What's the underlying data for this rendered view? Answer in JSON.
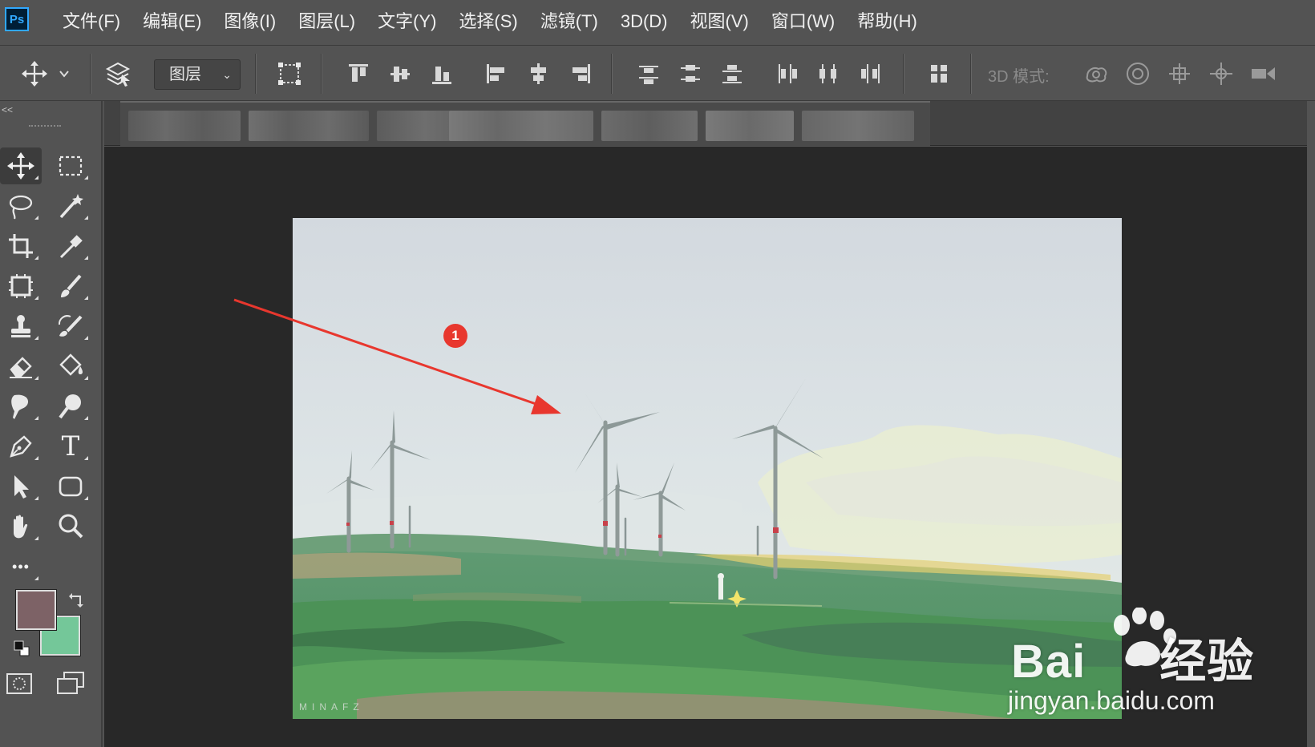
{
  "app": {
    "logo_text": "Ps",
    "menu": [
      "文件(F)",
      "编辑(E)",
      "图像(I)",
      "图层(L)",
      "文字(Y)",
      "选择(S)",
      "滤镜(T)",
      "3D(D)",
      "视图(V)",
      "窗口(W)",
      "帮助(H)"
    ]
  },
  "options_bar": {
    "auto_select_value": "图层",
    "mode_3d_label": "3D 模式:",
    "icons": [
      "move-icon",
      "layers-auto-select-icon",
      "transform-controls-icon",
      "align-top-icon",
      "align-vertical-center-icon",
      "align-bottom-icon",
      "align-left-icon",
      "align-horizontal-center-icon",
      "align-right-icon",
      "distribute-top-icon",
      "distribute-vertical-center-icon",
      "distribute-bottom-icon",
      "distribute-left-icon",
      "distribute-horizontal-center-icon",
      "distribute-right-icon",
      "auto-align-icon",
      "orbit-3d-icon",
      "roll-3d-icon",
      "pan-3d-icon",
      "slide-3d-icon",
      "scale-3d-icon"
    ]
  },
  "tools": {
    "collapse_label": "<<",
    "items": [
      "move-tool",
      "marquee-tool",
      "lasso-tool",
      "magic-wand-tool",
      "crop-tool",
      "eyedropper-tool",
      "frame-tool",
      "brush-tool",
      "stamp-tool",
      "history-brush-tool",
      "eraser-tool",
      "paint-bucket-tool",
      "smudge-tool",
      "dodge-tool",
      "pen-tool",
      "type-tool",
      "path-select-tool",
      "shape-tool",
      "hand-tool",
      "zoom-tool",
      "more-tools"
    ],
    "type_tool_glyph": "T",
    "more_glyph": "•••",
    "foreground_color": "#7d6266",
    "background_color": "#74c799"
  },
  "document": {
    "artwork_signature": "MINAFZ"
  },
  "annotation": {
    "step_number": "1",
    "color": "#e8372e"
  },
  "watermark": {
    "brand": "Bai",
    "brand_suffix": "经验",
    "url": "jingyan.baidu.com"
  }
}
